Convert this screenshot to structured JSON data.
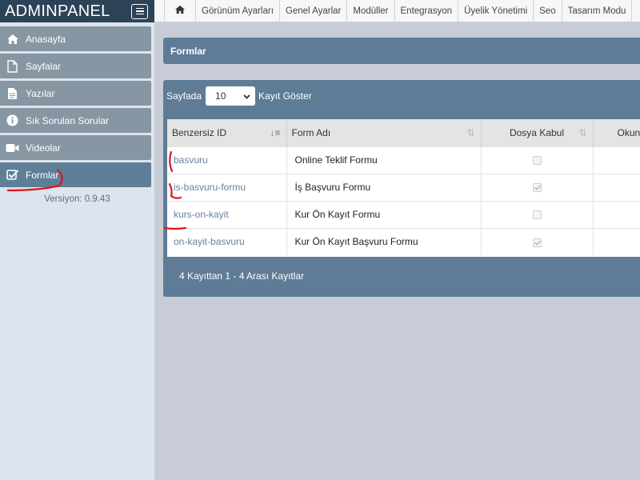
{
  "sidebar": {
    "brand": "ADMINPANEL",
    "items": [
      {
        "label": "Anasayfa",
        "icon": "home-icon"
      },
      {
        "label": "Sayfalar",
        "icon": "file-icon"
      },
      {
        "label": "Yazılar",
        "icon": "document-icon"
      },
      {
        "label": "Sık Sorulan Sorular",
        "icon": "info-icon"
      },
      {
        "label": "Videolar",
        "icon": "video-icon"
      },
      {
        "label": "Formlar",
        "icon": "checkbox-icon",
        "active": true
      }
    ],
    "version": "Versiyon: 0.9.43"
  },
  "topnav": {
    "items": [
      "Görünüm Ayarları",
      "Genel Ayarlar",
      "Modüller",
      "Entegrasyon",
      "Üyelik Yönetimi",
      "Seo",
      "Tasarım Modu"
    ]
  },
  "page": {
    "title": "Formlar"
  },
  "table_controls": {
    "show_prefix": "Sayfada",
    "page_size": "10",
    "show_suffix": "Kayıt Göster"
  },
  "table": {
    "columns": [
      "Benzersiz ID",
      "Form Adı",
      "Dosya Kabul",
      "Okun"
    ],
    "rows": [
      {
        "id": "basvuru",
        "name": "Online Teklif Formu",
        "file_accept": false
      },
      {
        "id": "is-basvuru-formu",
        "name": "İş Başvuru Formu",
        "file_accept": true
      },
      {
        "id": "kurs-on-kayit",
        "name": "Kur Ön Kayıt Formu",
        "file_accept": false
      },
      {
        "id": "on-kayit-basvuru",
        "name": "Kur Ön Kayıt Başvuru Formu",
        "file_accept": true
      }
    ],
    "info": "4 Kayıttan 1 - 4 Arası Kayıtlar"
  },
  "colors": {
    "brand_bar": "#2c4257",
    "panel": "#5e7c96",
    "nav_item": "#8796a3",
    "nav_active": "#5f7f98",
    "annotation": "#e2131b"
  }
}
